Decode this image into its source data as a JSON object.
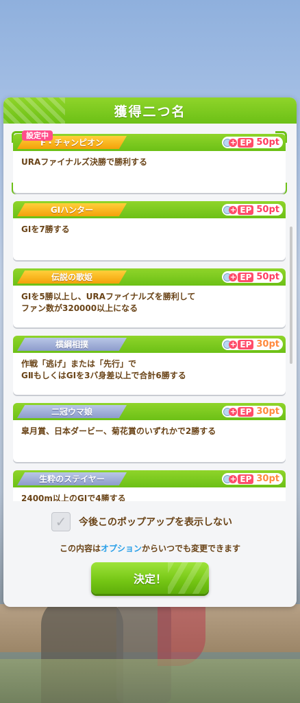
{
  "modal": {
    "title": "獲得二つ名",
    "selected_badge": "設定中"
  },
  "titles": [
    {
      "name": "F・チャンピオン",
      "tier": "gold",
      "ep_label": "EP",
      "points": "50pt",
      "description": "URAファイナルズ決勝で勝利する",
      "selected": true
    },
    {
      "name": "GⅠハンター",
      "tier": "gold",
      "ep_label": "EP",
      "points": "50pt",
      "description": "GⅠを7勝する",
      "selected": false
    },
    {
      "name": "伝説の歌姫",
      "tier": "gold",
      "ep_label": "EP",
      "points": "50pt",
      "description": "GⅠを5勝以上し、URAファイナルズを勝利して\nファン数が320000以上になる",
      "selected": false
    },
    {
      "name": "横綱相撲",
      "tier": "silver",
      "ep_label": "EP",
      "points": "30pt",
      "description": "作戦「逃げ」または「先行」で\nGⅡもしくはGⅠを3バ身差以上で合計6勝する",
      "selected": false
    },
    {
      "name": "二冠ウマ娘",
      "tier": "silver",
      "ep_label": "EP",
      "points": "30pt",
      "description": "皐月賞、日本ダービー、菊花賞のいずれかで2勝する",
      "selected": false
    },
    {
      "name": "生粋のステイヤー",
      "tier": "silver",
      "ep_label": "EP",
      "points": "30pt",
      "description": "2400m以上のGⅠで4勝する",
      "selected": false
    }
  ],
  "footer": {
    "checkbox_label": "今後このポップアップを表示しない",
    "checkbox_checked": false,
    "note_prefix": "この内容は",
    "note_link": "オプション",
    "note_suffix": "からいつでも変更できます",
    "ok_button": "決定！"
  },
  "colors": {
    "accent_green": "#6cc016",
    "text_brown": "#6a4418",
    "ep_pink": "#ff4d6a",
    "option_blue": "#2aa0e8"
  }
}
